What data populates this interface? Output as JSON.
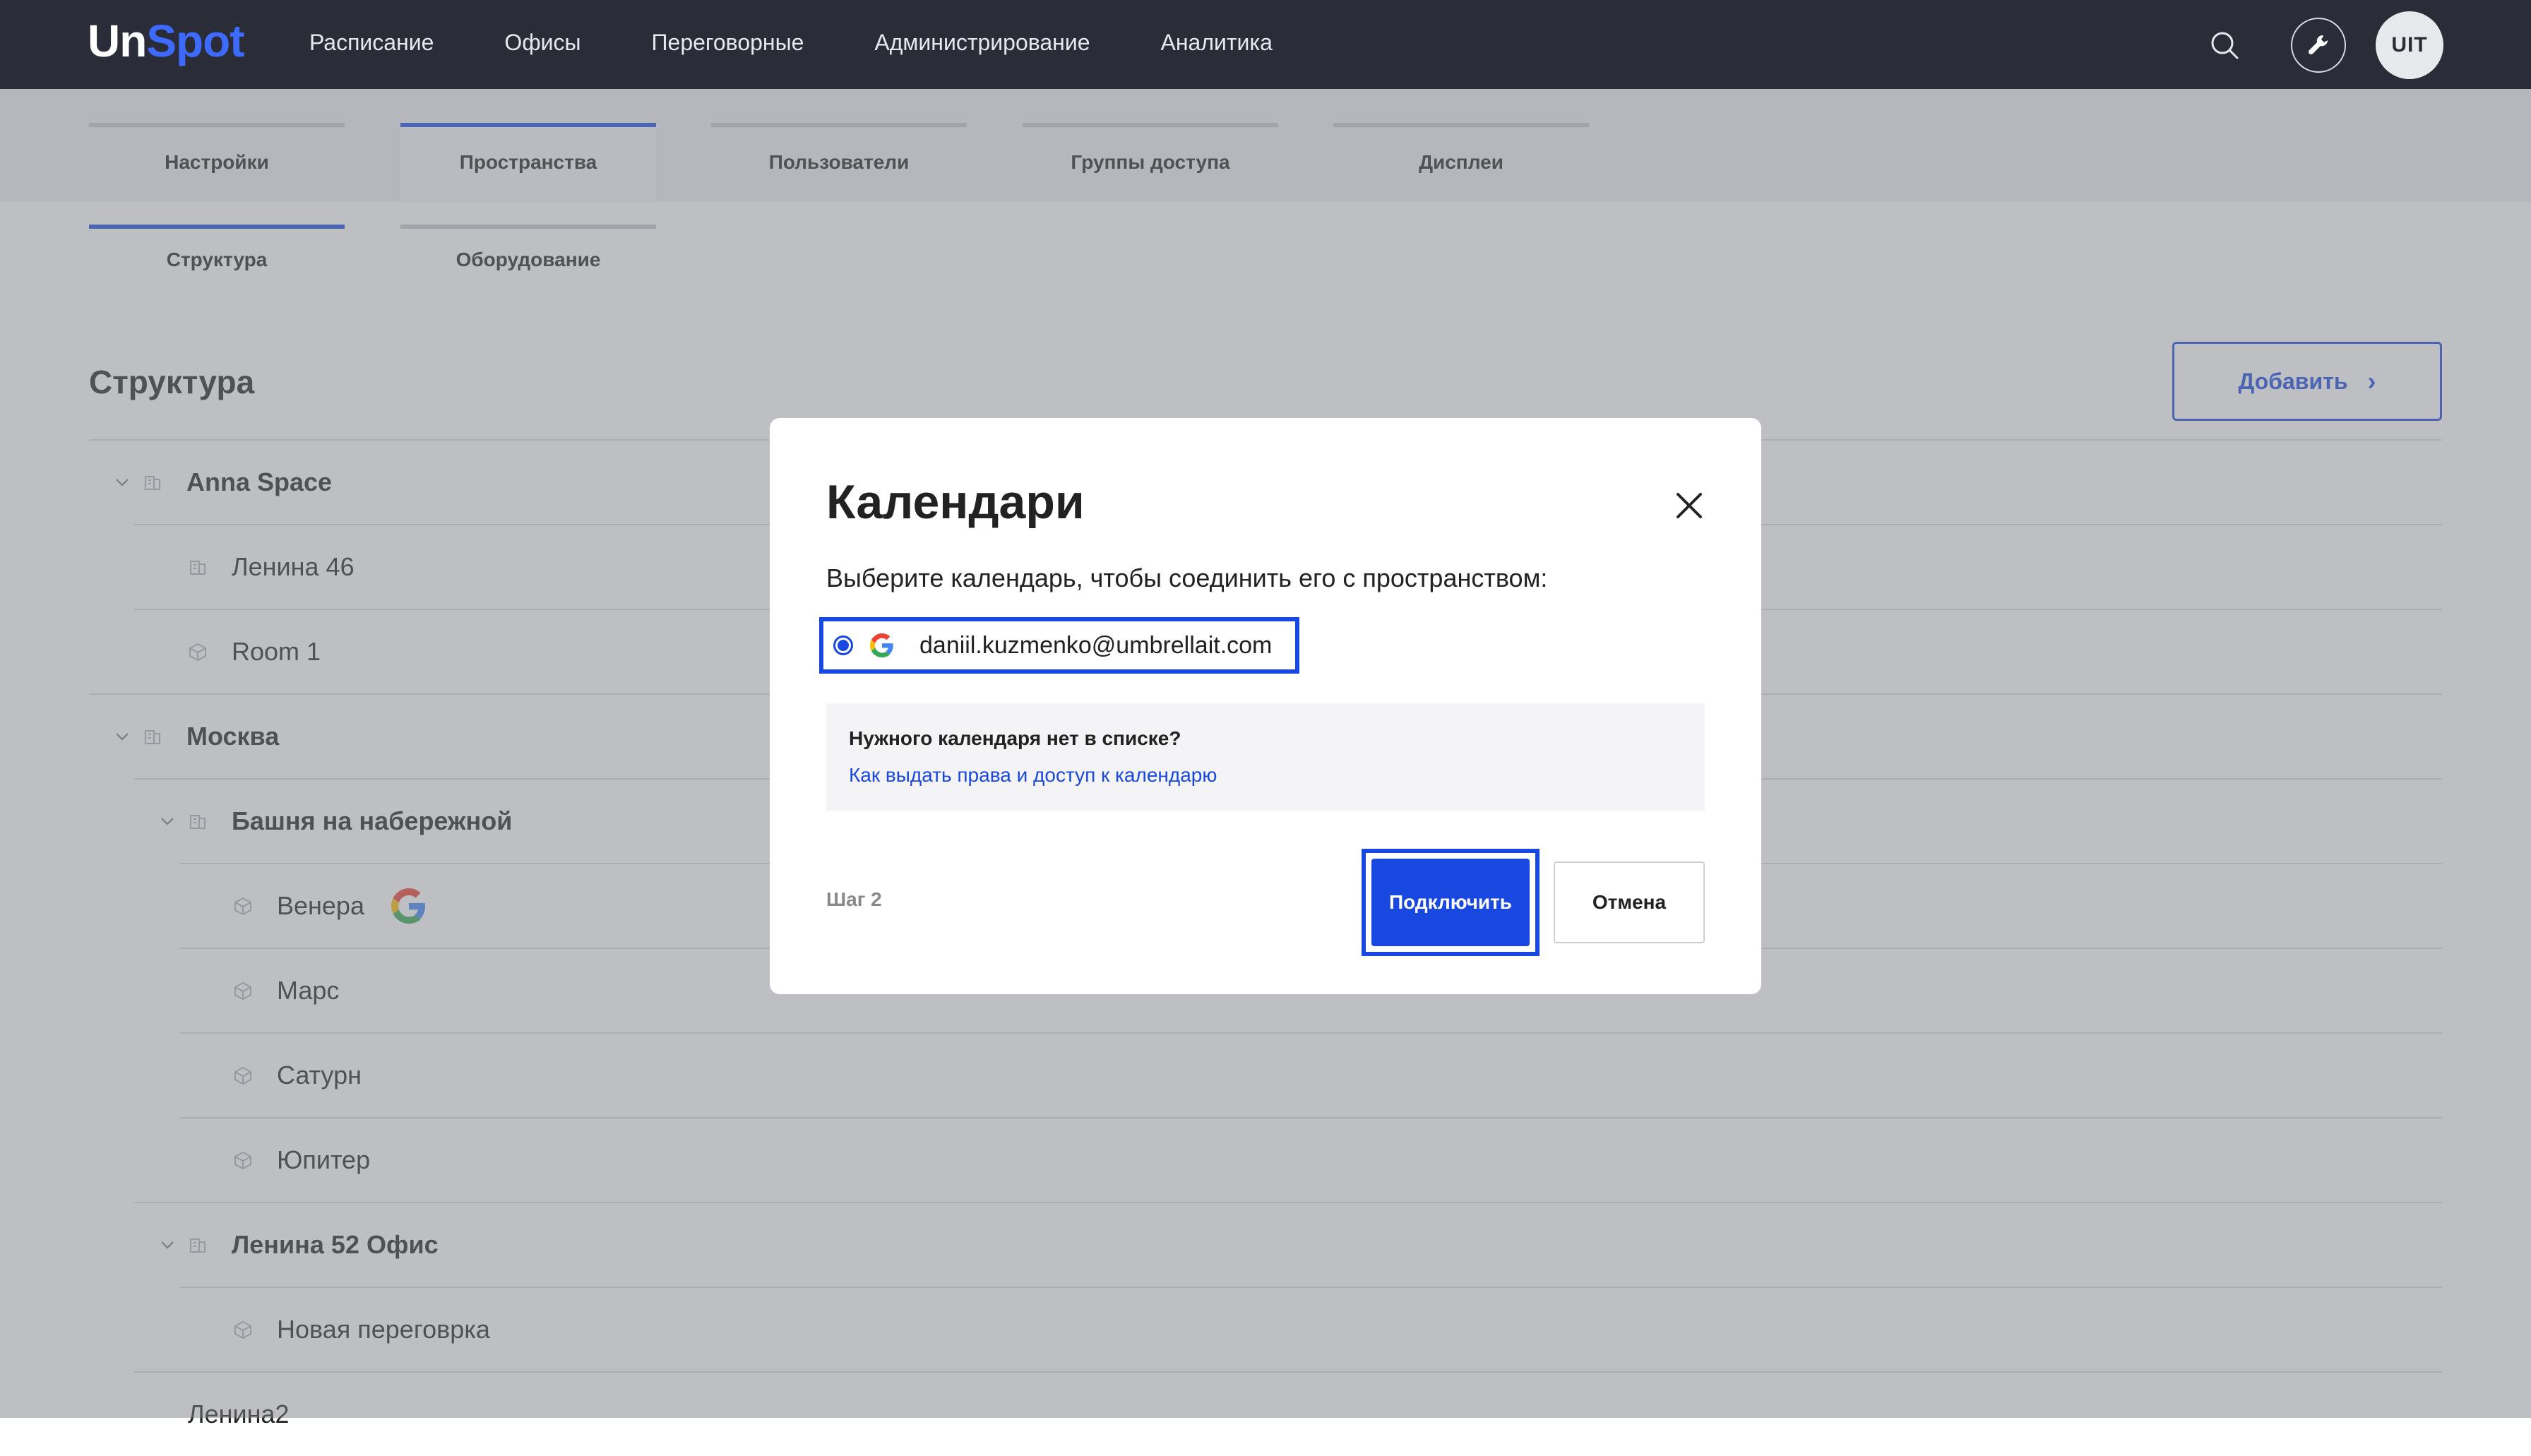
{
  "app": {
    "logo_part1": "Un",
    "logo_part2": "Spot",
    "avatar_initials": "UIT"
  },
  "nav": {
    "items": [
      "Расписание",
      "Офисы",
      "Переговорные",
      "Администрирование",
      "Аналитика"
    ]
  },
  "tabs": [
    "Настройки",
    "Пространства",
    "Пользователи",
    "Группы доступа",
    "Дисплеи"
  ],
  "subtabs": [
    "Структура",
    "Оборудование"
  ],
  "page": {
    "title": "Структура",
    "add_label": "Добавить"
  },
  "tree": [
    {
      "label": "Anna Space",
      "level": 0,
      "bold": true,
      "caret": true,
      "icon": "building-icon"
    },
    {
      "label": "Ленина 46",
      "level": 1,
      "bold": false,
      "caret": false,
      "icon": "building-icon"
    },
    {
      "label": "Room 1",
      "level": 1,
      "bold": false,
      "caret": false,
      "icon": "room-icon"
    },
    {
      "label": "Москва",
      "level": 0,
      "bold": true,
      "caret": true,
      "icon": "building-icon"
    },
    {
      "label": "Башня на набережной",
      "level": 1,
      "bold": true,
      "caret": true,
      "icon": "building-icon"
    },
    {
      "label": "Венера",
      "level": 2,
      "bold": false,
      "caret": false,
      "icon": "room-icon",
      "google": true
    },
    {
      "label": "Марс",
      "level": 2,
      "bold": false,
      "caret": false,
      "icon": "room-icon"
    },
    {
      "label": "Сатурн",
      "level": 2,
      "bold": false,
      "caret": false,
      "icon": "room-icon"
    },
    {
      "label": "Юпитер",
      "level": 2,
      "bold": false,
      "caret": false,
      "icon": "room-icon"
    },
    {
      "label": "Ленина 52 Офис",
      "level": 1,
      "bold": true,
      "caret": true,
      "icon": "building-icon"
    },
    {
      "label": "Новая переговрка",
      "level": 2,
      "bold": false,
      "caret": false,
      "icon": "room-icon"
    },
    {
      "label": "Ленина2",
      "level": 1,
      "bold": false,
      "caret": false,
      "icon": ""
    }
  ],
  "modal": {
    "title": "Календари",
    "subtitle": "Выберите календарь, чтобы соединить его с пространством:",
    "calendar_email": "daniil.kuzmenko@umbrellait.com",
    "info_title": "Нужного календаря нет в списке?",
    "info_link": "Как выдать права и доступ к календарю",
    "step": "Шаг 2",
    "connect_label": "Подключить",
    "cancel_label": "Отмена"
  },
  "colors": {
    "accent": "#1848e0",
    "nav_bg": "#2a2d38",
    "logo_accent": "#3e6bff"
  }
}
